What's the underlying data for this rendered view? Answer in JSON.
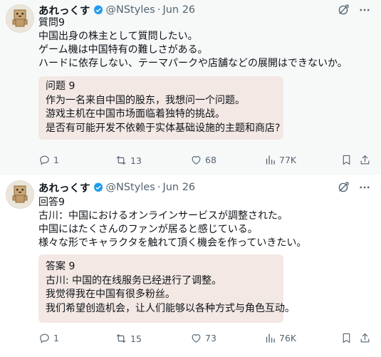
{
  "colors": {
    "verified": "#1d9bf0",
    "text": "#0f1419",
    "muted": "#536471",
    "quote_bg": "#f3e8e4",
    "first_tweet_bg": "#f7f9f9"
  },
  "tweets": [
    {
      "author_name": "あれっくす",
      "handle": "@NStyles",
      "separator": "·",
      "date": "Jun 26",
      "lines": [
        "質問9",
        "中国出身の株主として質問したい。",
        "ゲーム機は中国特有の難しさがある。",
        "ハードに依存しない、テーマパークや店舗などの展開はできないか。"
      ],
      "quote_lines": [
        "问题 9",
        "作为一名来自中国的股东，我想问一个问题。",
        "游戏主机在中国市场面临着独特的挑战。",
        "是否有可能开发不依赖于实体基础设施的主题和商店?"
      ],
      "stats": {
        "replies": "1",
        "reposts": "13",
        "likes": "68",
        "views": "77K"
      }
    },
    {
      "author_name": "あれっくす",
      "handle": "@NStyles",
      "separator": "·",
      "date": "Jun 26",
      "lines": [
        "回答9",
        "古川：中国におけるオンラインサービスが調整された。",
        "中国にはたくさんのファンが居ると感じている。",
        "様々な形でキャラクタを触れて頂く機会を作っていきたい。"
      ],
      "quote_lines": [
        "答案 9",
        "古川: 中国的在线服务已经进行了调整。",
        "我觉得我在中国有很多粉丝。",
        "我们希望创造机会，让人们能够以各种方式与角色互动。"
      ],
      "stats": {
        "replies": "1",
        "reposts": "15",
        "likes": "73",
        "views": "76K"
      }
    }
  ]
}
